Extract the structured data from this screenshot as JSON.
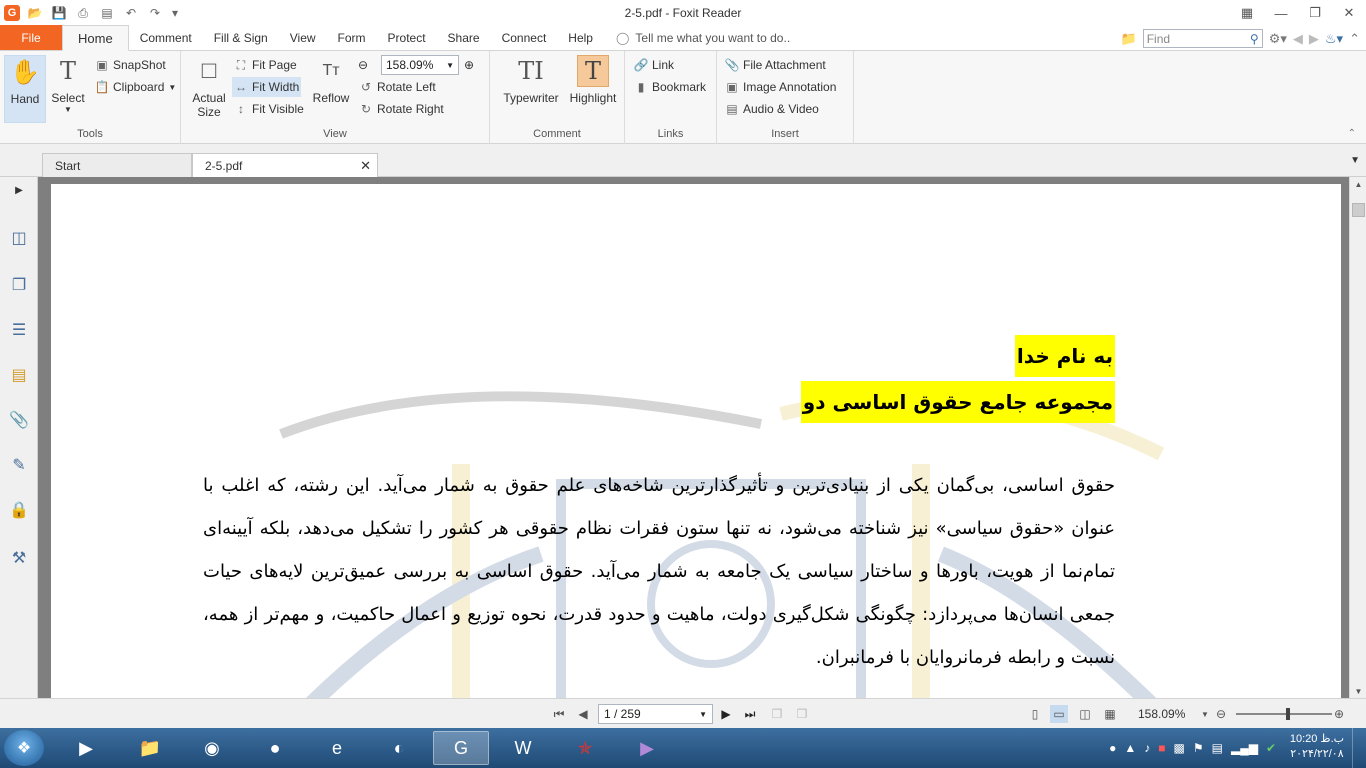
{
  "titlebar": {
    "title": "2-5.pdf - Foxit Reader",
    "qat_icons": [
      "foxit-logo-icon",
      "open-icon",
      "save-icon",
      "print-icon",
      "properties-icon",
      "undo-icon",
      "redo-icon",
      "customize-dropdown-icon"
    ]
  },
  "menu": {
    "file": "File",
    "tabs": [
      "Home",
      "Comment",
      "Fill & Sign",
      "View",
      "Form",
      "Protect",
      "Share",
      "Connect",
      "Help"
    ],
    "active_tab": "Home",
    "tell_me": "Tell me what you want to do..",
    "find_placeholder": "Find"
  },
  "ribbon": {
    "tools": {
      "label": "Tools",
      "hand": "Hand",
      "select": "Select",
      "snapshot": "SnapShot",
      "clipboard": "Clipboard"
    },
    "view": {
      "label": "View",
      "actual_size_line1": "Actual",
      "actual_size_line2": "Size",
      "fit_page": "Fit Page",
      "fit_width": "Fit Width",
      "fit_visible": "Fit Visible",
      "reflow": "Reflow",
      "zoom_value": "158.09%",
      "rotate_left": "Rotate Left",
      "rotate_right": "Rotate Right"
    },
    "comment": {
      "label": "Comment",
      "typewriter": "Typewriter",
      "highlight": "Highlight"
    },
    "links": {
      "label": "Links",
      "link": "Link",
      "bookmark": "Bookmark"
    },
    "insert": {
      "label": "Insert",
      "file_attachment": "File Attachment",
      "image_annotation": "Image Annotation",
      "audio_video": "Audio & Video"
    }
  },
  "doc_tabs": {
    "start": "Start",
    "file": "2-5.pdf"
  },
  "document": {
    "heading1": "به نام خدا",
    "heading2": "مجموعه جامع حقوق اساسی دو",
    "paragraph": "حقوق اساسی، بی‌گمان یکی از بنیادی‌ترین و تأثیرگذارترین شاخه‌های علم حقوق به شمار می‌آید. این رشته، که اغلب با عنوان «حقوق سیاسی» نیز شناخته می‌شود، نه تنها ستون فقرات نظام حقوقی هر کشور را تشکیل می‌دهد، بلکه آیینه‌ای تمام‌نما از هویت، باورها و ساختار سیاسی یک جامعه به شمار می‌آید. حقوق اساسی به بررسی عمیق‌ترین لایه‌های حیات جمعی انسان‌ها می‌پردازد: چگونگی شکل‌گیری دولت، ماهیت و حدود قدرت، نحوه توزیع و اعمال حاکمیت، و مهم‌تر از همه، نسبت و رابطه فرمانروایان با فرمانبران."
  },
  "statusbar": {
    "page_indicator": "1 / 259",
    "zoom": "158.09%"
  },
  "taskbar": {
    "apps": [
      "media-player-icon",
      "file-explorer-icon",
      "chrome-icon",
      "firefox-icon",
      "internet-explorer-icon",
      "edge-icon",
      "foxit-reader-icon",
      "word-icon",
      "app-icon",
      "visual-studio-icon"
    ],
    "active_app": "foxit-reader-icon",
    "clock_time": "ب.ظ 10:20",
    "clock_date": "۲۰۲۴/۲۲/۰۸"
  }
}
